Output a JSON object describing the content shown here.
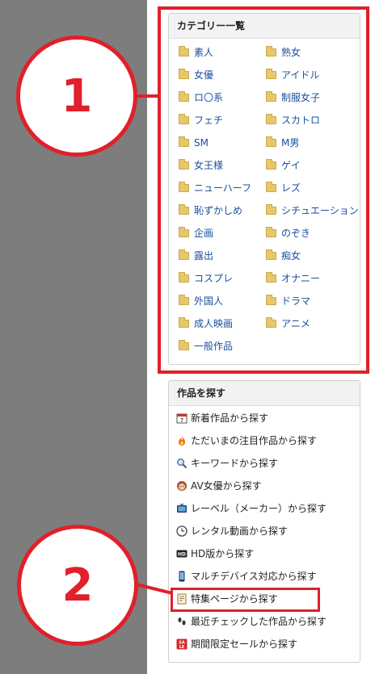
{
  "category_panel": {
    "title": "カテゴリー一覧",
    "items": [
      "素人",
      "熟女",
      "女優",
      "アイドル",
      "ロ〇系",
      "制服女子",
      "フェチ",
      "スカトロ",
      "SM",
      "M男",
      "女王様",
      "ゲイ",
      "ニューハーフ",
      "レズ",
      "恥ずかしめ",
      "シチュエーション",
      "企画",
      "のぞき",
      "露出",
      "痴女",
      "コスプレ",
      "オナニー",
      "外国人",
      "ドラマ",
      "成人映画",
      "アニメ",
      "一般作品"
    ]
  },
  "search_panel": {
    "title": "作品を探す",
    "items": [
      {
        "label": "新着作品から探す",
        "icon": "calendar-icon"
      },
      {
        "label": "ただいまの注目作品から探す",
        "icon": "flame-icon"
      },
      {
        "label": "キーワードから探す",
        "icon": "magnifier-icon"
      },
      {
        "label": "AV女優から探す",
        "icon": "actress-face-icon"
      },
      {
        "label": "レーベル（メーカー）から探す",
        "icon": "tv-icon"
      },
      {
        "label": "レンタル動画から探す",
        "icon": "clock-icon"
      },
      {
        "label": "HD版から探す",
        "icon": "hd-icon"
      },
      {
        "label": "マルチデバイス対応から探す",
        "icon": "smartphone-icon"
      },
      {
        "label": "特集ページから探す",
        "icon": "memo-icon"
      },
      {
        "label": "最近チェックした作品から探す",
        "icon": "footprints-icon"
      },
      {
        "label": "期間限定セールから探す",
        "icon": "sale-icon"
      }
    ]
  },
  "annotations": {
    "callout_1": "1",
    "callout_2": "2",
    "accent_color": "#e0202a"
  },
  "colors": {
    "link": "#1a4f9c",
    "sidebar_gray": "#7d7d7d",
    "folder": "#e6c86a"
  }
}
